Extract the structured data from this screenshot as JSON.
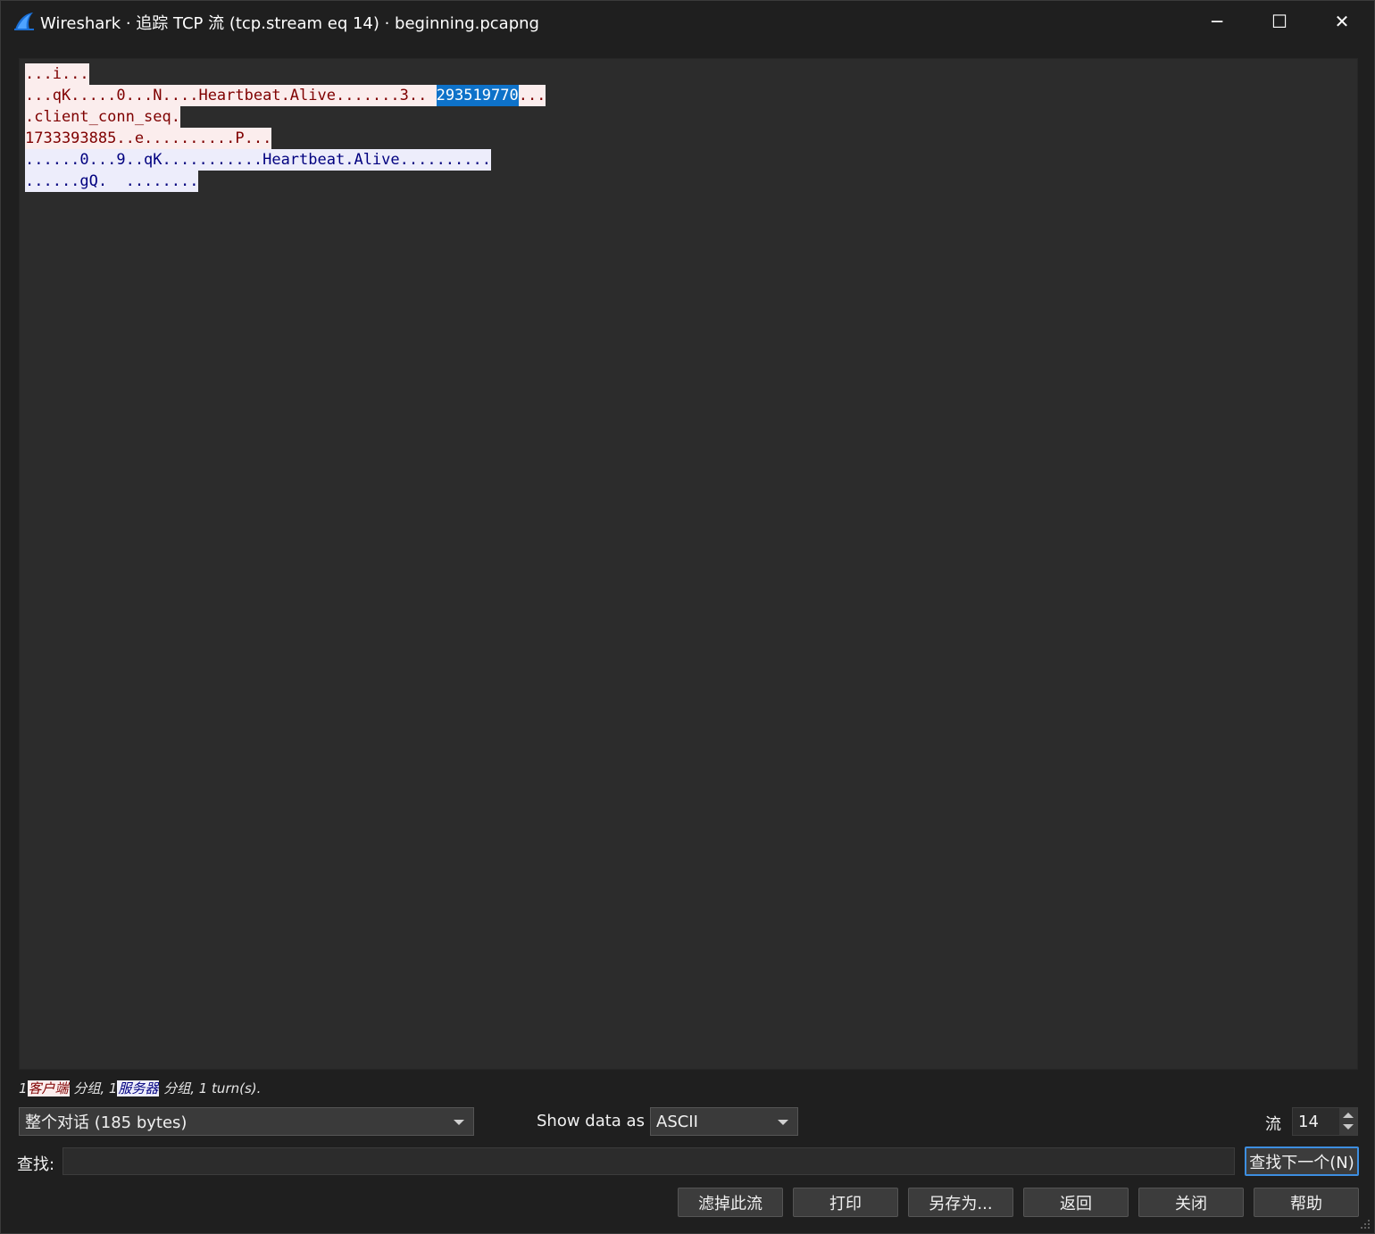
{
  "window": {
    "title": "Wireshark · 追踪 TCP 流 (tcp.stream eq 14) · beginning.pcapng",
    "app_icon": "wireshark-fin-icon",
    "controls": {
      "minimize": "─",
      "maximize": "☐",
      "close": "✕"
    }
  },
  "stream": {
    "lines": [
      {
        "segments": [
          {
            "dir": "client",
            "text": "...i..."
          }
        ]
      },
      {
        "segments": [
          {
            "dir": "client",
            "text": "...qK.....0...N....Heartbeat.Alive.......3.. "
          },
          {
            "dir": "selected",
            "text": "293519770"
          },
          {
            "dir": "client",
            "text": "..."
          }
        ]
      },
      {
        "segments": [
          {
            "dir": "client",
            "text": ".client_conn_seq."
          }
        ]
      },
      {
        "segments": [
          {
            "dir": "client",
            "text": "1733393885..e..........P..."
          }
        ]
      },
      {
        "segments": [
          {
            "dir": "server",
            "text": "......0...9..qK...........Heartbeat.Alive.........."
          }
        ]
      },
      {
        "segments": [
          {
            "dir": "server",
            "text": "......gQ.  ........"
          }
        ]
      }
    ],
    "colors": {
      "client_bg": "#fbeded",
      "client_fg": "#7f0000",
      "server_bg": "#ededfb",
      "server_fg": "#00007f",
      "selection": "#0e72c9"
    }
  },
  "stats": {
    "client_count": "1",
    "client_label": "客户端",
    "client_suffix": " 分组,",
    "server_count": " 1",
    "server_label": "服务器",
    "server_suffix": " 分组, 1 turn(s)."
  },
  "controls": {
    "conversation": "整个对话 (185 bytes)",
    "show_data_label": "Show data as",
    "show_data_value": "ASCII",
    "stream_label": "流",
    "stream_value": "14",
    "find_label": "查找:",
    "find_value": "",
    "find_next": "查找下一个(N)"
  },
  "buttons": {
    "filter_out": "滤掉此流",
    "print": "打印",
    "save_as": "另存为...",
    "back": "返回",
    "close": "关闭",
    "help": "帮助"
  }
}
